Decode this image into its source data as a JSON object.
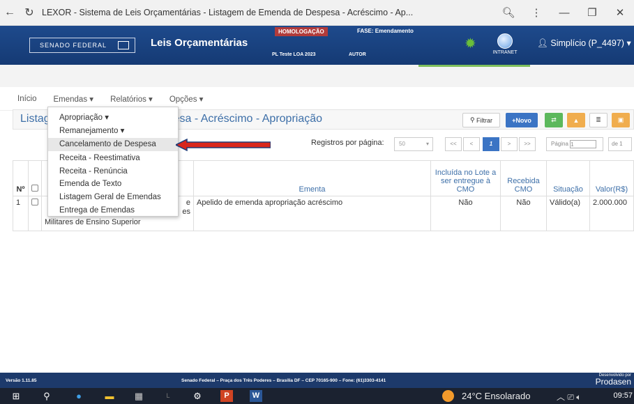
{
  "browser": {
    "title": "LEXOR - Sistema de Leis Orçamentárias - Listagem de Emenda de Despesa - Acréscimo - Ap..."
  },
  "header": {
    "logo_text": "SENADO FEDERAL",
    "app_title": "Leis Orçamentárias",
    "environment": "HOMOLOGAÇÃO",
    "phase": "FASE: Emendamento",
    "pl": "PL Teste LOA 2023",
    "role": "AUTOR",
    "intranet": "INTRANET",
    "user": "Simplício (P_4497)"
  },
  "nav": {
    "inicio": "Início",
    "emendas": "Emendas",
    "relatorios": "Relatórios",
    "opcoes": "Opções"
  },
  "dropdown": {
    "items": [
      "Apropriação",
      "Remanejamento",
      "Cancelamento de Despesa",
      "Receita - Reestimativa",
      "Receita - Renúncia",
      "Emenda de Texto",
      "Listagem Geral de Emendas",
      "Entrega de Emendas"
    ]
  },
  "panel": {
    "title_left": "Listag",
    "title_right": "pesa - Acréscimo - Apropriação",
    "filter_label": "Filtrar",
    "new_label": "+Novo"
  },
  "pager": {
    "records_label": "Registros por página:",
    "per_page": "50",
    "first": "<<",
    "prev": "<",
    "current": "1",
    "next": ">",
    "last": ">>",
    "page_label": "Página",
    "page_value": "1",
    "of_label": "de 1"
  },
  "table": {
    "headers": {
      "num": "Nº",
      "ementa": "Ementa",
      "lote": "Incluída no Lote a ser entregue à CMO",
      "recebida": "Recebida CMO",
      "situacao": "Situação",
      "valor": "Valor(R$)"
    },
    "row": {
      "num": "1",
      "autor_line1": "e",
      "autor_line2": "es",
      "autor_line3": "Militares de Ensino Superior",
      "ementa": "Apelido de emenda apropriação acréscimo",
      "lote": "Não",
      "recebida": "Não",
      "situacao": "Válido(a)",
      "valor": "2.000.000"
    }
  },
  "footer": {
    "version": "Versão 1.11.85",
    "address": "Senado Federal – Praça dos Três Poderes – Brasília DF – CEP 70165-900 – Fone: (61)3303-4141",
    "dev_label": "Desenvolvido por",
    "dev_name": "Prodasen"
  },
  "taskbar": {
    "weather": "24°C  Ensolarado",
    "time": "09:57"
  }
}
